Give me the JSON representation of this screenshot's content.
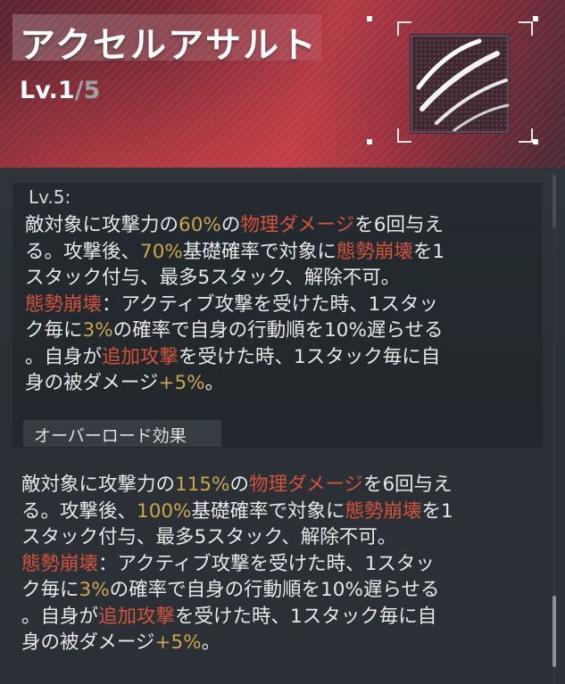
{
  "skill": {
    "name": "アクセルアサルト",
    "level_prefix": "Lv.1",
    "level_sep": "/",
    "level_max": "5",
    "icon": "claw-slash-icon"
  },
  "lv5": {
    "label": "Lv.5:",
    "lines": [
      [
        {
          "t": "敵対象に攻撃力の",
          "c": ""
        },
        {
          "t": "60%",
          "c": "y"
        },
        {
          "t": "の",
          "c": ""
        },
        {
          "t": "物理ダメージ",
          "c": "r"
        },
        {
          "t": "を6回与え",
          "c": ""
        }
      ],
      [
        {
          "t": "る。攻撃後、",
          "c": ""
        },
        {
          "t": "70%",
          "c": "y"
        },
        {
          "t": "基礎確率で対象に",
          "c": ""
        },
        {
          "t": "態勢崩壊",
          "c": "r"
        },
        {
          "t": "を1",
          "c": ""
        }
      ],
      [
        {
          "t": "スタック付与、最多5スタック、解除不可。",
          "c": ""
        }
      ],
      [
        {
          "t": "態勢崩壊",
          "c": "r"
        },
        {
          "t": "：アクティブ攻撃を受けた時、1スタッ",
          "c": ""
        }
      ],
      [
        {
          "t": "ク毎に",
          "c": ""
        },
        {
          "t": "3%",
          "c": "y"
        },
        {
          "t": "の確率で自身の行動順を10%遅らせる",
          "c": ""
        }
      ],
      [
        {
          "t": "。自身が",
          "c": ""
        },
        {
          "t": "追加攻撃",
          "c": "r"
        },
        {
          "t": "を受けた時、1スタック毎に自",
          "c": ""
        }
      ],
      [
        {
          "t": "身の被ダメージ",
          "c": ""
        },
        {
          "t": "+5%",
          "c": "y"
        },
        {
          "t": "。",
          "c": ""
        }
      ]
    ]
  },
  "overload": {
    "label": "オーバーロード効果",
    "lines": [
      [
        {
          "t": "敵対象に攻撃力の",
          "c": ""
        },
        {
          "t": "115%",
          "c": "y"
        },
        {
          "t": "の",
          "c": ""
        },
        {
          "t": "物理ダメージ",
          "c": "r"
        },
        {
          "t": "を6回与え",
          "c": ""
        }
      ],
      [
        {
          "t": "る。攻撃後、",
          "c": ""
        },
        {
          "t": "100%",
          "c": "y"
        },
        {
          "t": "基礎確率で対象に",
          "c": ""
        },
        {
          "t": "態勢崩壊",
          "c": "r"
        },
        {
          "t": "を1",
          "c": ""
        }
      ],
      [
        {
          "t": "スタック付与、最多5スタック、解除不可。",
          "c": ""
        }
      ],
      [
        {
          "t": "態勢崩壊",
          "c": "r"
        },
        {
          "t": "：アクティブ攻撃を受けた時、1スタッ",
          "c": ""
        }
      ],
      [
        {
          "t": "ク毎に",
          "c": ""
        },
        {
          "t": "3%",
          "c": "y"
        },
        {
          "t": "の確率で自身の行動順を10%遅らせる",
          "c": ""
        }
      ],
      [
        {
          "t": "。自身が",
          "c": ""
        },
        {
          "t": "追加攻撃",
          "c": "r"
        },
        {
          "t": "を受けた時、1スタック毎に自",
          "c": ""
        }
      ],
      [
        {
          "t": "身の被ダメージ",
          "c": ""
        },
        {
          "t": "+5%",
          "c": "y"
        },
        {
          "t": "。",
          "c": ""
        }
      ]
    ]
  },
  "colors": {
    "highlight_value": "#c9a74a",
    "highlight_keyword": "#d4533a",
    "header_accent": "#b33a45"
  }
}
